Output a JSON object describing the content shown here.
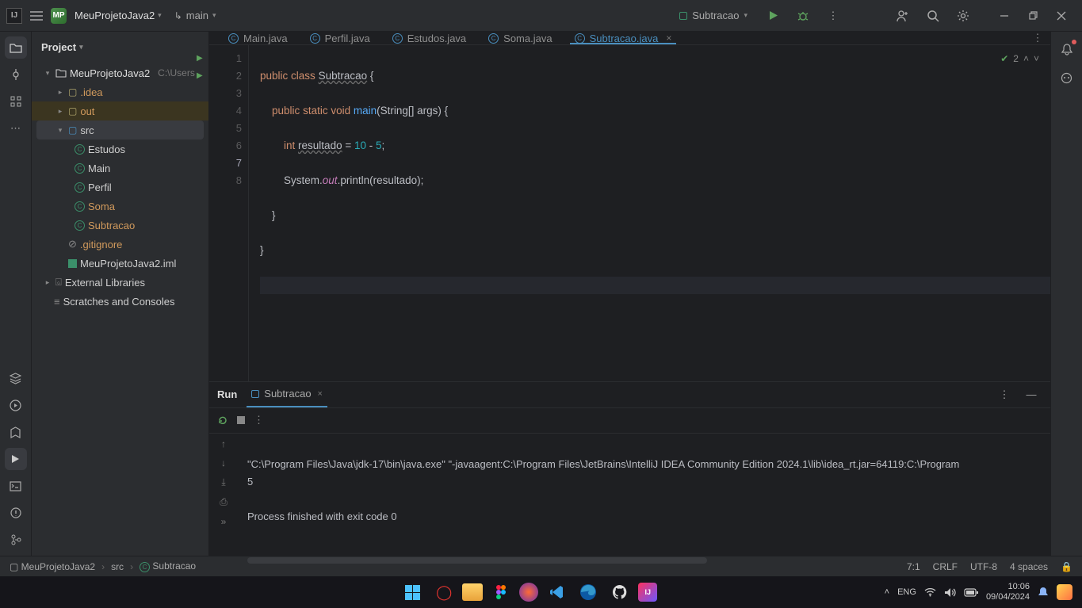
{
  "titlebar": {
    "project_badge": "MP",
    "project_name": "MeuProjetoJava2",
    "branch": "main",
    "run_config": "Subtracao"
  },
  "project_panel": {
    "title": "Project",
    "root": "MeuProjetoJava2",
    "root_path": "C:\\Users",
    "idea_folder": ".idea",
    "out_folder": "out",
    "src_folder": "src",
    "files": {
      "estudos": "Estudos",
      "main": "Main",
      "perfil": "Perfil",
      "soma": "Soma",
      "subtracao": "Subtracao"
    },
    "gitignore": ".gitignore",
    "iml": "MeuProjetoJava2.iml",
    "ext_libs": "External Libraries",
    "scratches": "Scratches and Consoles"
  },
  "tabs": {
    "main": "Main.java",
    "perfil": "Perfil.java",
    "estudos": "Estudos.java",
    "soma": "Soma.java",
    "subtracao": "Subtracao.java"
  },
  "code": {
    "l1_a": "public",
    "l1_b": "class",
    "l1_c": "Subtracao",
    "l1_d": " {",
    "l2_a": "public",
    "l2_b": "static",
    "l2_c": "void",
    "l2_d": "main",
    "l2_e": "(String[] args) {",
    "l3_a": "int",
    "l3_b": "resultado",
    "l3_c": " = ",
    "l3_d": "10",
    "l3_e": " - ",
    "l3_f": "5",
    "l3_g": ";",
    "l4_a": "System.",
    "l4_b": "out",
    "l4_c": ".println(resultado);",
    "l5": "    }",
    "l6": "}"
  },
  "editor": {
    "problems": "2"
  },
  "gutter": {
    "n1": "1",
    "n2": "2",
    "n3": "3",
    "n4": "4",
    "n5": "5",
    "n6": "6",
    "n7": "7",
    "n8": "8"
  },
  "run": {
    "title": "Run",
    "tab": "Subtracao",
    "out1": "\"C:\\Program Files\\Java\\jdk-17\\bin\\java.exe\" \"-javaagent:C:\\Program Files\\JetBrains\\IntelliJ IDEA Community Edition 2024.1\\lib\\idea_rt.jar=64119:C:\\Program",
    "out2": "5",
    "out3": "",
    "out4": "Process finished with exit code 0"
  },
  "breadcrumb": {
    "b1": "MeuProjetoJava2",
    "b2": "src",
    "b3": "Subtracao"
  },
  "status": {
    "pos": "7:1",
    "eol": "CRLF",
    "enc": "UTF-8",
    "indent": "4 spaces"
  },
  "tray": {
    "lang": "ENG",
    "time": "10:06",
    "date": "09/04/2024"
  }
}
